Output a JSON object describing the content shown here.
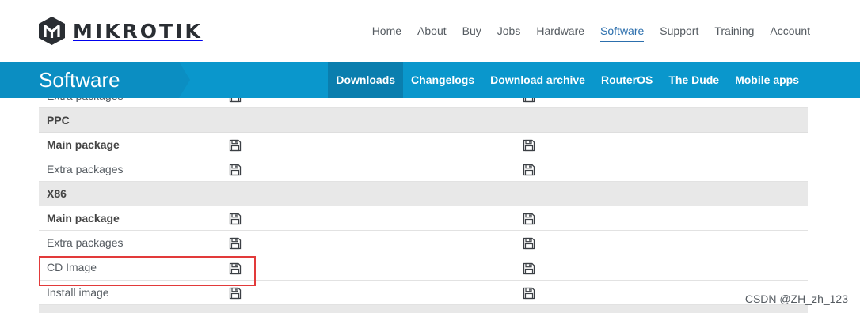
{
  "header": {
    "brand": "MIKROTIK",
    "nav": [
      "Home",
      "About",
      "Buy",
      "Jobs",
      "Hardware",
      "Software",
      "Support",
      "Training",
      "Account"
    ],
    "active_nav": "Software"
  },
  "subbar": {
    "title": "Software",
    "nav": [
      "Downloads",
      "Changelogs",
      "Download archive",
      "RouterOS",
      "The Dude",
      "Mobile apps"
    ],
    "active_nav": "Downloads"
  },
  "table": {
    "rows": [
      {
        "type": "item",
        "label": "Extra packages",
        "bold": false
      },
      {
        "type": "group",
        "label": "PPC"
      },
      {
        "type": "item",
        "label": "Main package",
        "bold": true
      },
      {
        "type": "item",
        "label": "Extra packages",
        "bold": false
      },
      {
        "type": "group",
        "label": "X86"
      },
      {
        "type": "item",
        "label": "Main package",
        "bold": true
      },
      {
        "type": "item",
        "label": "Extra packages",
        "bold": false
      },
      {
        "type": "item",
        "label": "CD Image",
        "bold": false
      },
      {
        "type": "item",
        "label": "Install image",
        "bold": false
      }
    ],
    "download_icon": "floppy-disk-icon"
  },
  "highlight_target": "CD Image",
  "watermark": "CSDN @ZH_zh_123",
  "colors": {
    "bar": "#0a97cc",
    "bar_active": "#0a7eae",
    "active_link": "#2c6fad",
    "highlight": "#e23a3a"
  }
}
